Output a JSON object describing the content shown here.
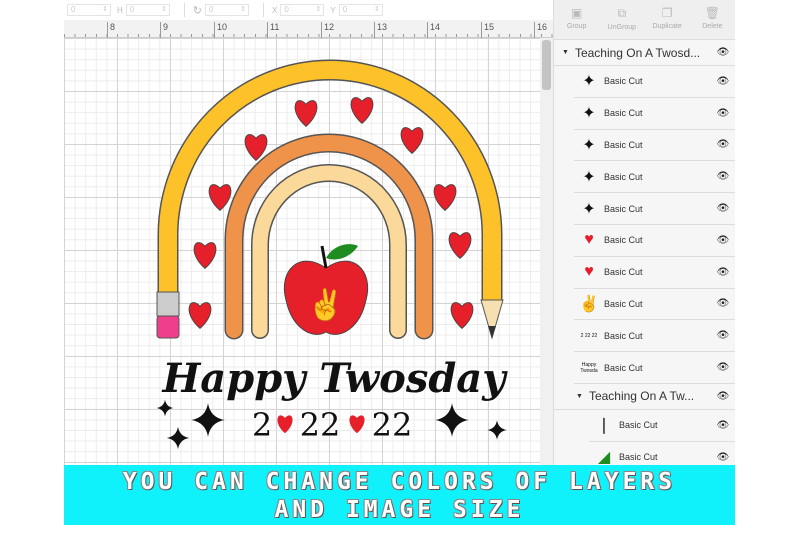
{
  "toolbar": {
    "w_value": "0",
    "h_label": "H",
    "h_value": "0",
    "rotate_value": "0",
    "x_label": "X",
    "x_value": "0",
    "y_label": "Y",
    "y_value": "0"
  },
  "ruler": [
    "8",
    "9",
    "10",
    "11",
    "12",
    "13",
    "14",
    "15",
    "16"
  ],
  "panel": {
    "tools": [
      {
        "label": "Group",
        "icon": "group-icon"
      },
      {
        "label": "UnGroup",
        "icon": "ungroup-icon"
      },
      {
        "label": "Duplicate",
        "icon": "duplicate-icon"
      },
      {
        "label": "Delete",
        "icon": "trash-icon"
      }
    ],
    "group1": {
      "name": "Teaching On A Twosd...",
      "layers": [
        {
          "label": "Basic Cut",
          "thumb": "sparkle"
        },
        {
          "label": "Basic Cut",
          "thumb": "sparkle"
        },
        {
          "label": "Basic Cut",
          "thumb": "sparkle"
        },
        {
          "label": "Basic Cut",
          "thumb": "sparkle"
        },
        {
          "label": "Basic Cut",
          "thumb": "sparkle"
        },
        {
          "label": "Basic Cut",
          "thumb": "heart"
        },
        {
          "label": "Basic Cut",
          "thumb": "heart"
        },
        {
          "label": "Basic Cut",
          "thumb": "peace-hand"
        },
        {
          "label": "Basic Cut",
          "thumb": "numbers"
        },
        {
          "label": "Basic Cut",
          "thumb": "text"
        }
      ]
    },
    "group2": {
      "name": "Teaching On A Tw...",
      "layers": [
        {
          "label": "Basic Cut",
          "thumb": "stem"
        },
        {
          "label": "Basic Cut",
          "thumb": "leaf"
        }
      ]
    }
  },
  "artwork": {
    "title": "Happy Twosday",
    "num1": "2",
    "num2": "22",
    "num3": "22"
  },
  "banner": {
    "line1": "YOU CAN CHANGE COLORS OF LAYERS",
    "line2": "AND IMAGE SIZE"
  },
  "colors": {
    "yellow": "#fdc12a",
    "orange": "#f0934a",
    "beige": "#fbd99a",
    "heart": "#e5202a",
    "banner": "#10f2fb"
  }
}
